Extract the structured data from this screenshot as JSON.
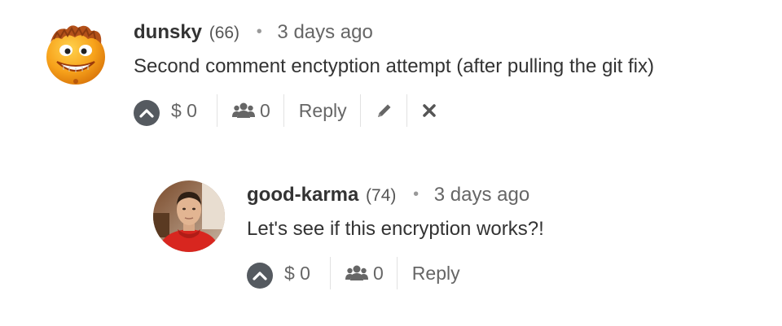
{
  "comments": [
    {
      "author": "dunsky",
      "reputation": "(66)",
      "separator": "•",
      "time": "3 days ago",
      "text": "Second comment enctyption attempt (after pulling the git fix)",
      "payout": "$ 0",
      "voters": "0",
      "reply_label": "Reply"
    },
    {
      "author": "good-karma",
      "reputation": "(74)",
      "separator": "•",
      "time": "3 days ago",
      "text": "Let's see if this encryption works?!",
      "payout": "$ 0",
      "voters": "0",
      "reply_label": "Reply"
    }
  ],
  "icons": {
    "vote": "chevron-up-icon",
    "voters": "users-icon",
    "edit": "pencil-icon",
    "delete": "close-icon"
  }
}
